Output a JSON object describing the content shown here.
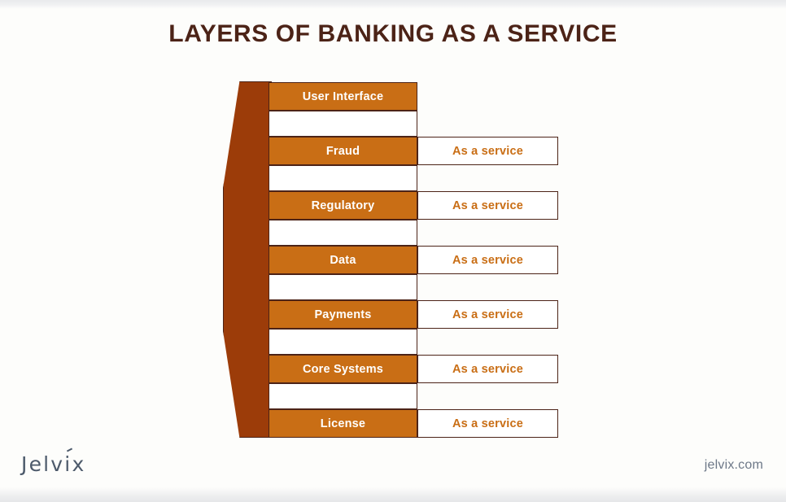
{
  "slide": {
    "title": "LAYERS OF BANKING AS A SERVICE",
    "background_color": "#fdfdfb"
  },
  "colors": {
    "bar_orange": "#c96e15",
    "side_dark_brown": "#9c3c09",
    "outline_brown": "#4c2317",
    "title_brown": "#4c2317",
    "service_text_orange": "#c96e15",
    "footer_slate": "#4d5a6b",
    "white": "#ffffff"
  },
  "diagram": {
    "type": "layered-stack",
    "service_label": "As a service",
    "layers": [
      {
        "name": "User Interface",
        "service": "",
        "has_service_box": false
      },
      {
        "name": "Fraud",
        "service": "As a service",
        "has_service_box": true
      },
      {
        "name": "Regulatory",
        "service": "As a service",
        "has_service_box": true
      },
      {
        "name": "Data",
        "service": "As a service",
        "has_service_box": true
      },
      {
        "name": "Payments",
        "service": "As a service",
        "has_service_box": true
      },
      {
        "name": "Core Systems",
        "service": "As a service",
        "has_service_box": true
      },
      {
        "name": "License",
        "service": "As a service",
        "has_service_box": true
      }
    ]
  },
  "footer": {
    "logo_pre": "Jelv",
    "logo_accent": "i",
    "logo_post": "x",
    "logo_text": "Jelvix",
    "website": "jelvix.com"
  }
}
